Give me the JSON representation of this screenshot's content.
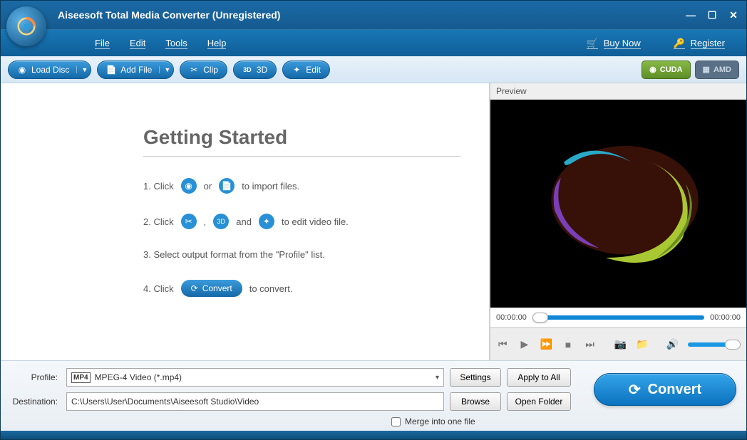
{
  "window": {
    "title": "Aiseesoft Total Media Converter (Unregistered)"
  },
  "menu": {
    "file": "File",
    "edit": "Edit",
    "tools": "Tools",
    "help": "Help",
    "buy": "Buy Now",
    "register": "Register"
  },
  "toolbar": {
    "load_disc": "Load Disc",
    "add_file": "Add File",
    "clip": "Clip",
    "three_d": "3D",
    "edit_btn": "Edit",
    "cuda": "CUDA",
    "amd": "AMD"
  },
  "started": {
    "heading": "Getting Started",
    "s1a": "1. Click",
    "s1b": "or",
    "s1c": "to import files.",
    "s2a": "2. Click",
    "s2b": ",",
    "s2c": "and",
    "s2d": "to edit video file.",
    "s3": "3. Select output format from the \"Profile\" list.",
    "s4a": "4. Click",
    "s4b": "to convert.",
    "convert_label": "Convert"
  },
  "preview": {
    "label": "Preview",
    "t_start": "00:00:00",
    "t_end": "00:00:00"
  },
  "footer": {
    "profile_label": "Profile:",
    "profile_value": "MPEG-4 Video (*.mp4)",
    "settings": "Settings",
    "apply": "Apply to All",
    "dest_label": "Destination:",
    "dest_value": "C:\\Users\\User\\Documents\\Aiseesoft Studio\\Video",
    "browse": "Browse",
    "open_folder": "Open Folder",
    "merge": "Merge into one file",
    "convert": "Convert"
  }
}
